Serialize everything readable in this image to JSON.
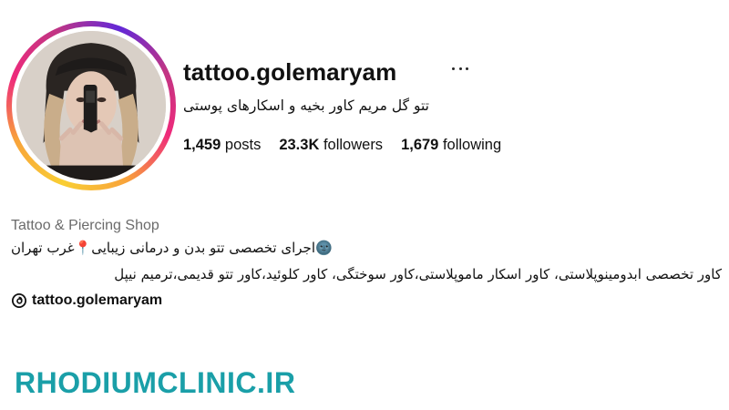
{
  "profile": {
    "username": "tattoo.golemaryam",
    "full_name": "تتو گل مریم کاور بخیه و اسکارهای پوستی",
    "more_icon": "more-horizontal-icon",
    "ring_colors": [
      "#f9ce34",
      "#ee2a7b",
      "#6228d7"
    ]
  },
  "stats": {
    "posts_count": "1,459",
    "posts_label": "posts",
    "followers_count": "23.3K",
    "followers_label": "followers",
    "following_count": "1,679",
    "following_label": "following"
  },
  "bio": {
    "category": "Tattoo & Piercing Shop",
    "line1": "🌚اجرای تخصصی تتو بدن و درمانی زیبایی📍غرب تهران",
    "line2": "کاور تخصصی ابدومینوپلاستی، کاور اسکار ماموپلاستی،کاور سوختگی، کاور کلوئید،کاور تتو قدیمی،ترمیم نیپل",
    "threads_icon": "threads-icon",
    "threads_handle": "tattoo.golemaryam"
  },
  "watermark": {
    "text": "RHODIUMCLINIC.IR",
    "color": "#1a9fa8"
  }
}
